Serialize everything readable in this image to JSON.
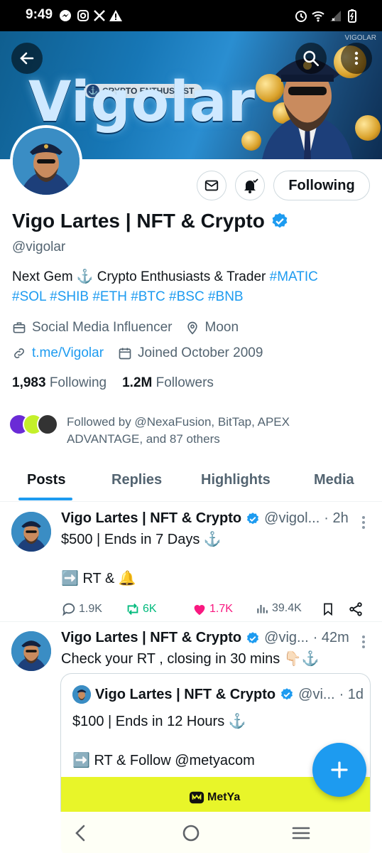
{
  "status_bar": {
    "time": "9:49"
  },
  "banner": {
    "brand": "Vigolar",
    "tag": "CRYPTO ENTHUSIAST",
    "watermark": "VIGOLAR"
  },
  "profile": {
    "name": "Vigo Lartes | NFT & Crypto",
    "handle": "@vigolar",
    "bio_text": "Next Gem ⚓ Crypto Enthusiasts & Trader ",
    "bio_tag_inline": "#MATIC",
    "bio_tags": "#SOL #SHIB #ETH #BTC #BSC #BNB",
    "category": "Social Media Influencer",
    "location": "Moon",
    "link": "t.me/Vigolar",
    "joined": "Joined October 2009",
    "following_count": "1,983",
    "following_label": "Following",
    "followers_count": "1.2M",
    "followers_label": "Followers",
    "followed_by": "Followed by @NexaFusion, BitTap, APEX ADVANTAGE, and 87 others",
    "following_button": "Following"
  },
  "tabs": [
    {
      "label": "Posts",
      "active": true
    },
    {
      "label": "Replies"
    },
    {
      "label": "Highlights"
    },
    {
      "label": "Media"
    }
  ],
  "posts": [
    {
      "name": "Vigo Lartes | NFT & Crypto",
      "handle": "@vigol...",
      "time": "· 2h",
      "line1": "$500  | Ends in 7 Days  ⚓",
      "line2": "➡️ RT & 🔔",
      "replies": "1.9K",
      "reposts": "6K",
      "likes": "1.7K",
      "views": "39.4K"
    },
    {
      "name": "Vigo Lartes | NFT & Crypto",
      "handle": "@vig...",
      "time": "· 42m",
      "line1": "Check your RT , closing in 30 mins 👇🏻⚓",
      "quote": {
        "name": "Vigo Lartes | NFT & Crypto",
        "handle": "@vi...",
        "time": "· 1d",
        "line1": "$100 | Ends in 12 Hours ⚓",
        "line2": "➡️ RT & Follow @metyacom",
        "promo_brand": "MetYa"
      }
    }
  ],
  "colors": {
    "accent": "#1d9bf0",
    "like": "#f91880",
    "repost": "#00ba7c",
    "promo": "#e8f529"
  }
}
